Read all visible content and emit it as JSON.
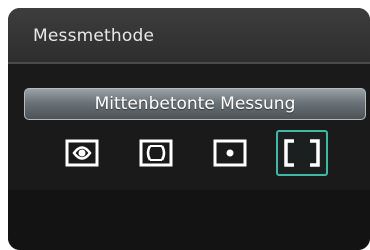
{
  "header": {
    "title": "Messmethode"
  },
  "selected_mode": {
    "label": "Mittenbetonte Messung"
  },
  "modes": [
    {
      "icon": "evaluative-metering-icon",
      "selected": false
    },
    {
      "icon": "partial-metering-icon",
      "selected": false
    },
    {
      "icon": "spot-metering-icon",
      "selected": false
    },
    {
      "icon": "center-weighted-metering-icon",
      "selected": true
    }
  ],
  "colors": {
    "selection_outline": "#3fb9a6",
    "background": "#1a1a1a",
    "icon": "#ffffff"
  }
}
